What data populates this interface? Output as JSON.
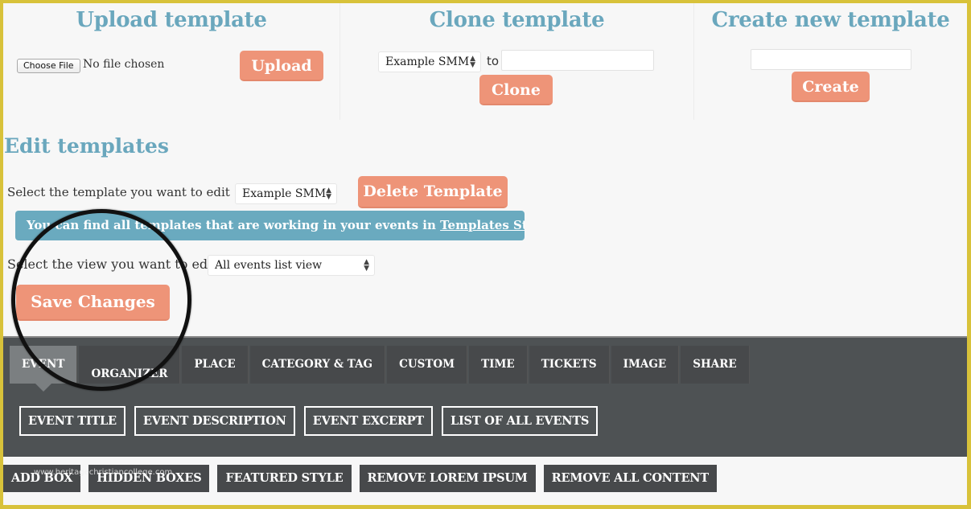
{
  "upload": {
    "title": "Upload template",
    "choose_file_label": "Choose File",
    "file_status": "No file chosen",
    "upload_label": "Upload"
  },
  "clone": {
    "title": "Clone template",
    "source_select": "Example SMM",
    "to_label": "to",
    "target_value": "",
    "clone_label": "Clone"
  },
  "create": {
    "title": "Create new template",
    "name_value": "",
    "create_label": "Create"
  },
  "edit": {
    "title": "Edit templates",
    "select_template_label": "Select the template you want to edit",
    "template_select": "Example SMM",
    "delete_label": "Delete Template",
    "info_text": "You can find all templates that are working in your events in ",
    "info_link": "Templates Status",
    "select_view_label": "Select the view you want to edit",
    "view_select": "All events list view",
    "save_label": "Save Changes"
  },
  "tabs": [
    {
      "label": "EVENT",
      "active": true
    },
    {
      "label": "ORGANIZER",
      "active": false
    },
    {
      "label": "PLACE",
      "active": false
    },
    {
      "label": "CATEGORY & TAG",
      "active": false
    },
    {
      "label": "CUSTOM",
      "active": false
    },
    {
      "label": "TIME",
      "active": false
    },
    {
      "label": "TICKETS",
      "active": false
    },
    {
      "label": "IMAGE",
      "active": false
    },
    {
      "label": "SHARE",
      "active": false
    }
  ],
  "fields": [
    "EVENT TITLE",
    "EVENT DESCRIPTION",
    "EVENT EXCERPT",
    "LIST OF ALL EVENTS"
  ],
  "actions": [
    "ADD BOX",
    "HIDDEN BOXES",
    "FEATURED STYLE",
    "REMOVE LOREM IPSUM",
    "REMOVE ALL CONTENT"
  ],
  "watermark": "www.heritagechristiancollege.com",
  "colors": {
    "accent_title": "#6aa7bd",
    "button_salmon": "#ee9478",
    "info_bar": "#6aaabf",
    "editor_bg": "#4e5254",
    "frame_border": "#d8c23a"
  }
}
